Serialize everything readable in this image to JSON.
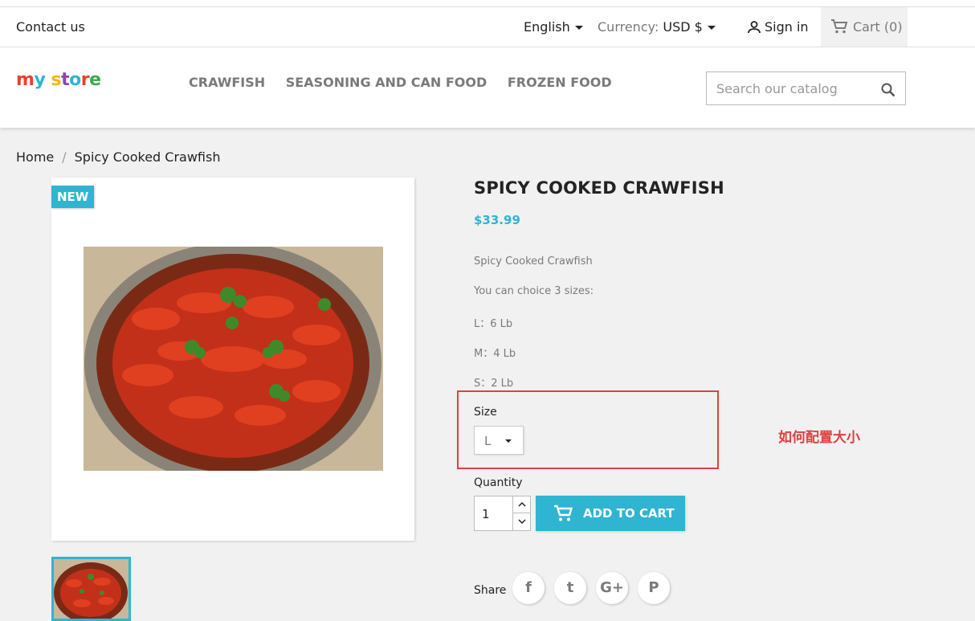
{
  "topbar": {
    "contact": "Contact us",
    "language": "English",
    "currency_label": "Currency:",
    "currency_value": "USD $",
    "sign_in": "Sign in",
    "cart": "Cart (0)"
  },
  "header": {
    "logo": "my store",
    "nav": [
      "CRAWFISH",
      "SEASONING AND CAN FOOD",
      "FROZEN FOOD"
    ],
    "search_placeholder": "Search our catalog"
  },
  "breadcrumb": [
    "Home",
    "Spicy Cooked Crawfish"
  ],
  "product": {
    "badge": "NEW",
    "title": "SPICY COOKED CRAWFISH",
    "price": "$33.99",
    "description": [
      "Spicy Cooked Crawfish",
      "You can choice 3 sizes:",
      "L：6 Lb",
      "M：4 Lb",
      "S：2 Lb"
    ],
    "size_label": "Size",
    "size_value": "L",
    "quantity_label": "Quantity",
    "quantity_value": "1",
    "add_to_cart": "ADD TO CART",
    "share_label": "Share",
    "share_icons": [
      "f",
      "t",
      "G+",
      "P"
    ]
  },
  "annotation": "如何配置大小",
  "colors": {
    "accent": "#2fb5d2",
    "annotation": "#e04040"
  }
}
